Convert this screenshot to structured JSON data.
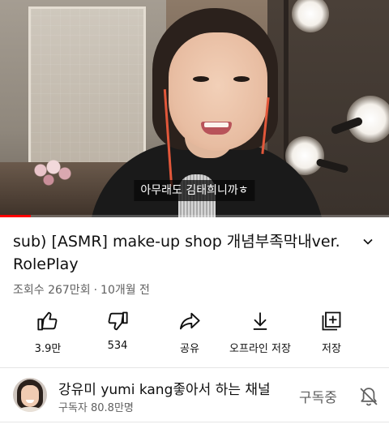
{
  "video": {
    "subtitle": "아무래도 김태희니까ㅎ",
    "progress_fraction": 0.08,
    "accent_color": "#ff0000"
  },
  "details": {
    "title": "sub) [ASMR] make-up shop 개념부족막내ver. RolePlay",
    "views": "조회수 267만회",
    "separator": "·",
    "age": "10개월 전",
    "expand_icon": "chevron-down-icon"
  },
  "actions": [
    {
      "label": "3.9만",
      "icon": "thumb-up-icon"
    },
    {
      "label": "534",
      "icon": "thumb-down-icon"
    },
    {
      "label": "공유",
      "icon": "share-icon"
    },
    {
      "label": "오프라인 저장",
      "icon": "download-icon"
    },
    {
      "label": "저장",
      "icon": "save-playlist-icon"
    }
  ],
  "channel": {
    "name": "강유미 yumi kang좋아서 하는 채널",
    "subscribers": "구독자 80.8만명",
    "subscribe_state": "구독중",
    "bell_icon": "bell-off-icon"
  }
}
